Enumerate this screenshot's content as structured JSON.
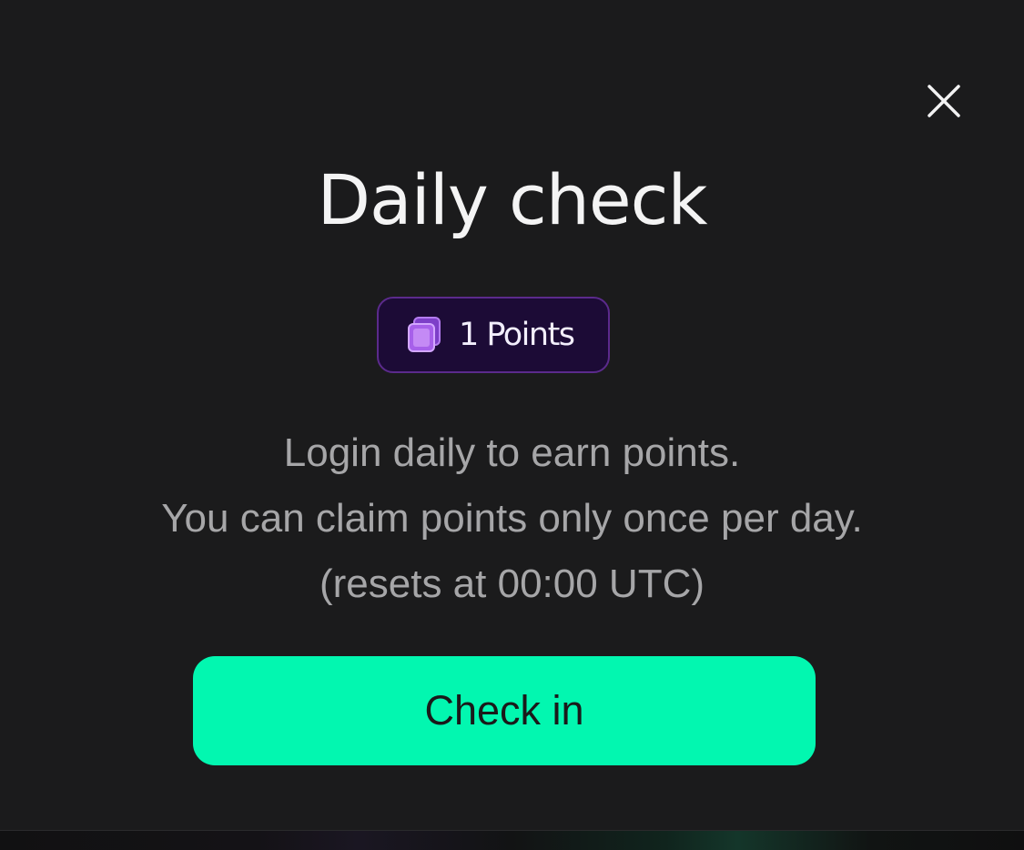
{
  "modal": {
    "title": "Daily check",
    "close_icon": "close-icon",
    "reward": {
      "label": "1 Points",
      "icon": "points-stack-icon",
      "accent_color": "#9b5de5"
    },
    "description": [
      "Login daily to earn points.",
      "You can claim points only once per day.",
      "(resets at 00:00 UTC)"
    ],
    "primary_button": {
      "label": "Check in",
      "color": "#02f7b0"
    }
  }
}
